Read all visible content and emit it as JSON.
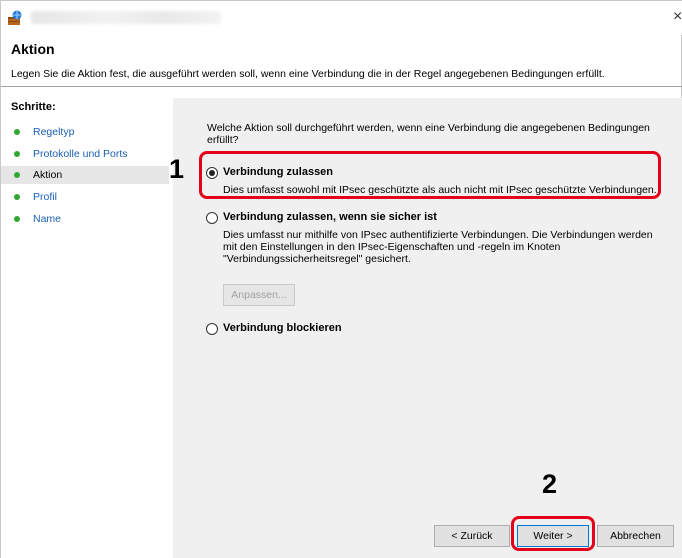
{
  "header": {
    "title": "Aktion",
    "description": "Legen Sie die Aktion fest, die ausgeführt werden soll, wenn eine Verbindung die in der Regel angegebenen Bedingungen erfüllt."
  },
  "sidebar": {
    "title": "Schritte:",
    "items": [
      {
        "label": "Regeltyp"
      },
      {
        "label": "Protokolle und Ports"
      },
      {
        "label": "Aktion"
      },
      {
        "label": "Profil"
      },
      {
        "label": "Name"
      }
    ]
  },
  "main": {
    "question": "Welche Aktion soll durchgeführt werden, wenn eine Verbindung die angegebenen Bedingungen erfüllt?",
    "options": [
      {
        "label": "Verbindung zulassen",
        "description": "Dies umfasst sowohl mit IPsec geschützte als auch nicht mit IPsec geschützte Verbindungen.",
        "checked": true
      },
      {
        "label": "Verbindung zulassen, wenn sie sicher ist",
        "description": "Dies umfasst nur mithilfe von IPsec authentifizierte Verbindungen. Die Verbindungen werden mit den Einstellungen in den IPsec-Eigenschaften und -regeln im Knoten \"Verbindungssicherheitsregel\" gesichert.",
        "checked": false
      },
      {
        "label": "Verbindung blockieren",
        "checked": false
      }
    ],
    "customize_button": "Anpassen..."
  },
  "footer": {
    "back_button": "< Zurück",
    "next_button": "Weiter >",
    "cancel_button": "Abbrechen"
  },
  "callouts": {
    "one": "1",
    "two": "2"
  },
  "colors": {
    "highlight": "#e3001b",
    "step_dot": "#2ea82e",
    "link": "#1a5fb4"
  }
}
